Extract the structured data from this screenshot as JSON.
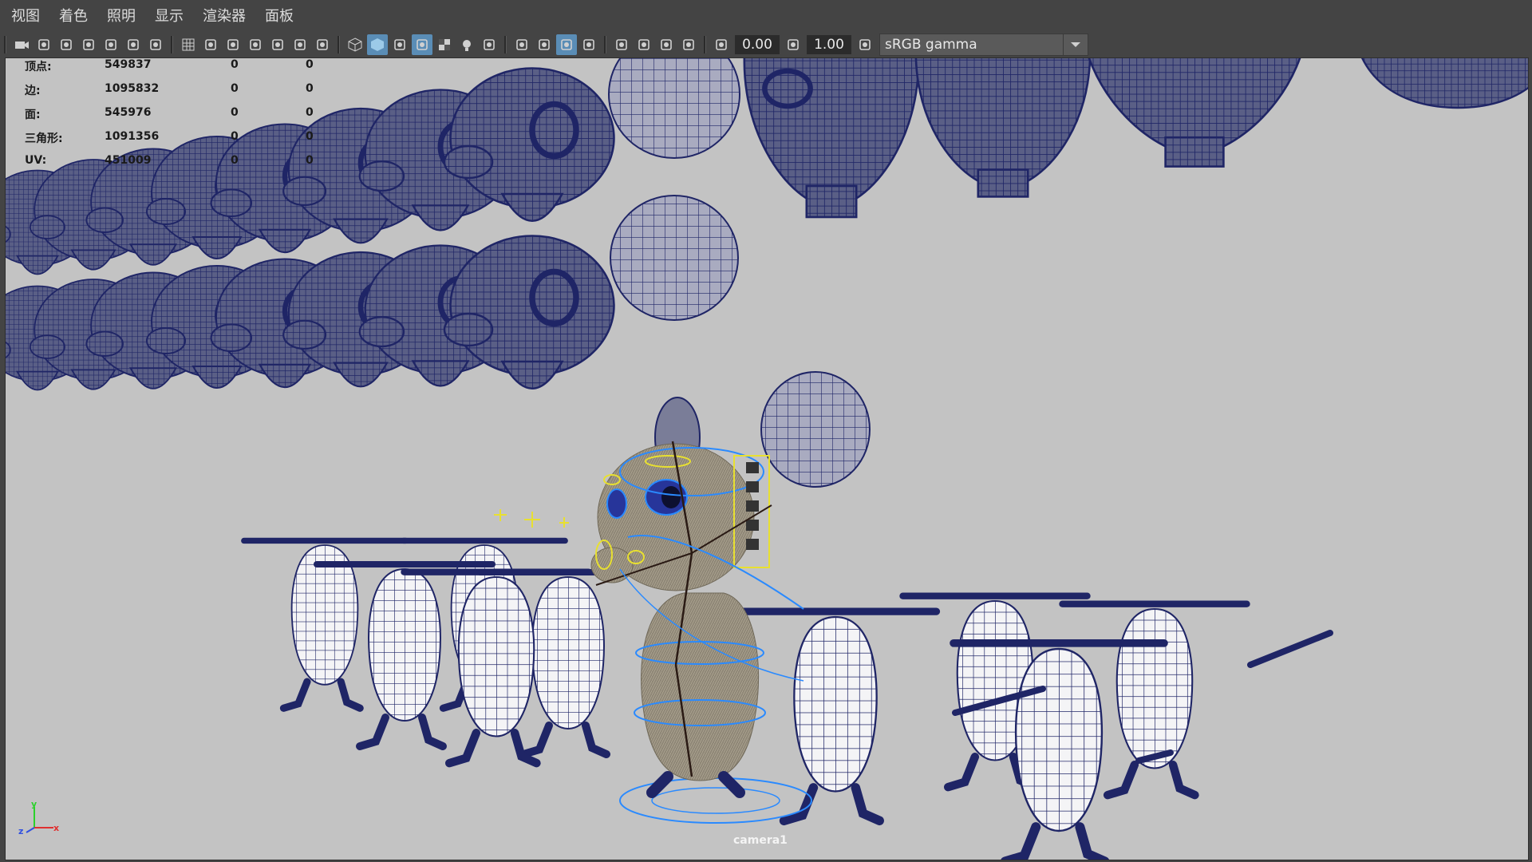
{
  "menu": [
    "视图",
    "着色",
    "照明",
    "显示",
    "渲染器",
    "面板"
  ],
  "toolbar": {
    "exposure_value": "0.00",
    "gamma_value": "1.00",
    "color_space": "sRGB gamma",
    "icons_group1": [
      "camera-icon",
      "camera-attr-icon",
      "bookmark-camera-icon",
      "bookmark-icon",
      "image-plane-icon",
      "pan-zoom-icon",
      "grease-pencil-icon"
    ],
    "icons_group2": [
      "grid-icon",
      "film-gate-icon",
      "resolution-gate-icon",
      "gate-mask-icon",
      "field-chart-icon",
      "safe-action-icon",
      "safe-title-icon"
    ],
    "icons_group3": [
      "wireframe-icon",
      "smooth-shade-icon",
      "use-default-material-icon",
      "wireframe-on-shaded-icon",
      "textured-icon",
      "use-lights-icon",
      "shadows-icon"
    ],
    "icons_group4": [
      "screen-space-ao-icon",
      "motion-blur-icon",
      "multisample-aa-icon",
      "depth-of-field-icon"
    ],
    "icons_group5": [
      "isolate-select-icon",
      "xray-icon",
      "xray-active-icon",
      "xray-joints-icon"
    ],
    "active_buttons": [
      "smooth-shade-icon",
      "wireframe-on-shaded-icon",
      "multisample-aa-icon"
    ],
    "colors": {
      "active": "#5a8db6",
      "field_bg": "#2b2b2b"
    }
  },
  "hud": {
    "rows": [
      {
        "label": "顶点:",
        "v1": "549837",
        "v2": "0",
        "v3": "0"
      },
      {
        "label": "边:",
        "v1": "1095832",
        "v2": "0",
        "v3": "0"
      },
      {
        "label": "面:",
        "v1": "545976",
        "v2": "0",
        "v3": "0"
      },
      {
        "label": "三角形:",
        "v1": "1091356",
        "v2": "0",
        "v3": "0"
      },
      {
        "label": "UV:",
        "v1": "451009",
        "v2": "0",
        "v3": "0"
      }
    ]
  },
  "viewport": {
    "camera_name": "camera1",
    "axis_labels": [
      "y",
      "z",
      "x"
    ],
    "colors": {
      "background": "#c3c3c3",
      "wire": "#1f2566",
      "fur": "#8e8676",
      "rig_yellow": "#e8e030",
      "rig_blue": "#2a8aff"
    }
  }
}
